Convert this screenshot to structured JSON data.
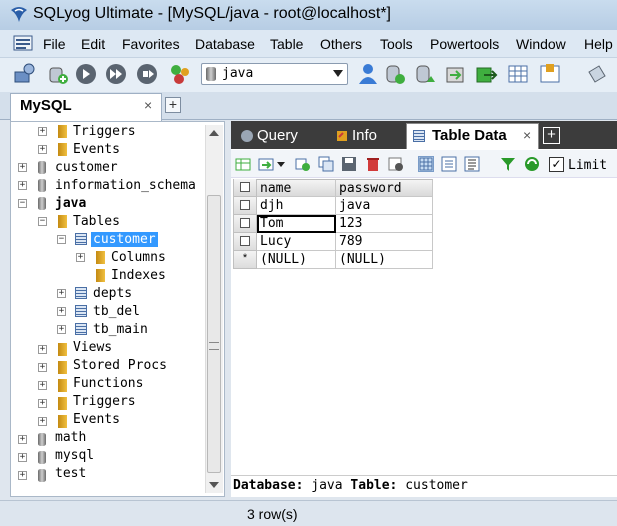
{
  "window": {
    "title": "SQLyog Ultimate - [MySQL/java - root@localhost*]"
  },
  "menu": {
    "items": [
      "File",
      "Edit",
      "Favorites",
      "Database",
      "Table",
      "Others",
      "Tools",
      "Powertools",
      "Window",
      "Help"
    ]
  },
  "toolbar": {
    "database_select": "java"
  },
  "connection_tab": {
    "label": "MySQL",
    "close": "×",
    "add": "+"
  },
  "tree": {
    "triggers_top": "Triggers",
    "events_top": "Events",
    "db_customer": "customer",
    "db_information_schema": "information_schema",
    "db_java": "java",
    "tables": "Tables",
    "table_customer": "customer",
    "columns": "Columns",
    "indexes": "Indexes",
    "table_depts": "depts",
    "table_tb_del": "tb_del",
    "table_tb_main": "tb_main",
    "views": "Views",
    "stored_procs": "Stored Procs",
    "functions": "Functions",
    "triggers": "Triggers",
    "events": "Events",
    "db_math": "math",
    "db_mysql": "mysql",
    "db_test": "test"
  },
  "result_tabs": {
    "query": "Query",
    "info": "Info",
    "table_data": "Table Data",
    "close": "×"
  },
  "grid_toolbar": {
    "limit_label": "Limit",
    "limit_checked": "✓"
  },
  "grid": {
    "columns": [
      "name",
      "password"
    ],
    "rows": [
      [
        "djh",
        "java"
      ],
      [
        "Tom",
        "123"
      ],
      [
        "Lucy",
        "789"
      ]
    ],
    "new_row": [
      "(NULL)",
      "(NULL)"
    ],
    "new_row_marker": "*"
  },
  "status_info": {
    "db_label": "Database:",
    "db_value": "java",
    "table_label": "Table:",
    "table_value": "customer"
  },
  "statusbar": {
    "rows": "3 row(s)"
  },
  "colors": {
    "title_bg": "#c9dcee",
    "selected": "#3399ff",
    "tabbar_dark": "#3c3c3c"
  }
}
